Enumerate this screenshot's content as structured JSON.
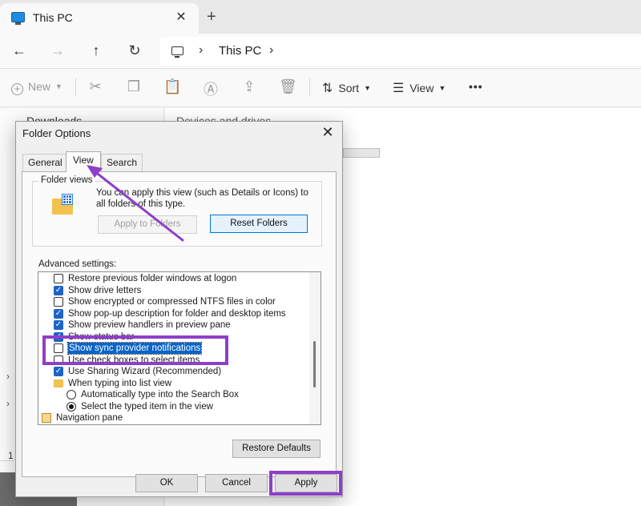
{
  "window": {
    "tab_title": "This PC",
    "tab_close": "✕",
    "new_tab": "+"
  },
  "nav": {
    "back": "←",
    "forward": "→",
    "up": "↑",
    "refresh": "↻",
    "sep": "›",
    "breadcrumb": "This PC"
  },
  "toolbar": {
    "new_label": "New",
    "sort_label": "Sort",
    "view_label": "View",
    "more": "•••"
  },
  "leftpane": {
    "downloads": "Downloads",
    "chevron": "›",
    "status_number": "1"
  },
  "content": {
    "category": "Devices and drives"
  },
  "dialog": {
    "title": "Folder Options",
    "close": "✕",
    "tabs": [
      "General",
      "View",
      "Search"
    ],
    "folder_views_label": "Folder views",
    "folder_views_text": "You can apply this view (such as Details or Icons) to all folders of this type.",
    "apply_to_folders": "Apply to Folders",
    "reset_folders": "Reset Folders",
    "advanced_label": "Advanced settings:",
    "settings": [
      {
        "type": "checkbox",
        "label": "Restore previous folder windows at logon",
        "checked": false
      },
      {
        "type": "checkbox",
        "label": "Show drive letters",
        "checked": true
      },
      {
        "type": "checkbox",
        "label": "Show encrypted or compressed NTFS files in color",
        "checked": false
      },
      {
        "type": "checkbox",
        "label": "Show pop-up description for folder and desktop items",
        "checked": true
      },
      {
        "type": "checkbox",
        "label": "Show preview handlers in preview pane",
        "checked": true
      },
      {
        "type": "checkbox",
        "label": "Show status bar",
        "checked": true
      },
      {
        "type": "checkbox",
        "label": "Show sync provider notifications",
        "checked": false,
        "selected": true
      },
      {
        "type": "checkbox",
        "label": "Use check boxes to select items",
        "checked": false
      },
      {
        "type": "checkbox",
        "label": "Use Sharing Wizard (Recommended)",
        "checked": true
      },
      {
        "type": "folder",
        "label": "When typing into list view"
      },
      {
        "type": "radio",
        "label": "Automatically type into the Search Box",
        "checked": false
      },
      {
        "type": "radio",
        "label": "Select the typed item in the view",
        "checked": true
      },
      {
        "type": "navpane",
        "label": "Navigation pane"
      }
    ],
    "restore_defaults": "Restore Defaults",
    "ok": "OK",
    "cancel": "Cancel",
    "apply": "Apply"
  },
  "colors": {
    "annotation": "#8e3fc8",
    "selection": "#0a64c8",
    "checkbox": "#1a64c8"
  }
}
